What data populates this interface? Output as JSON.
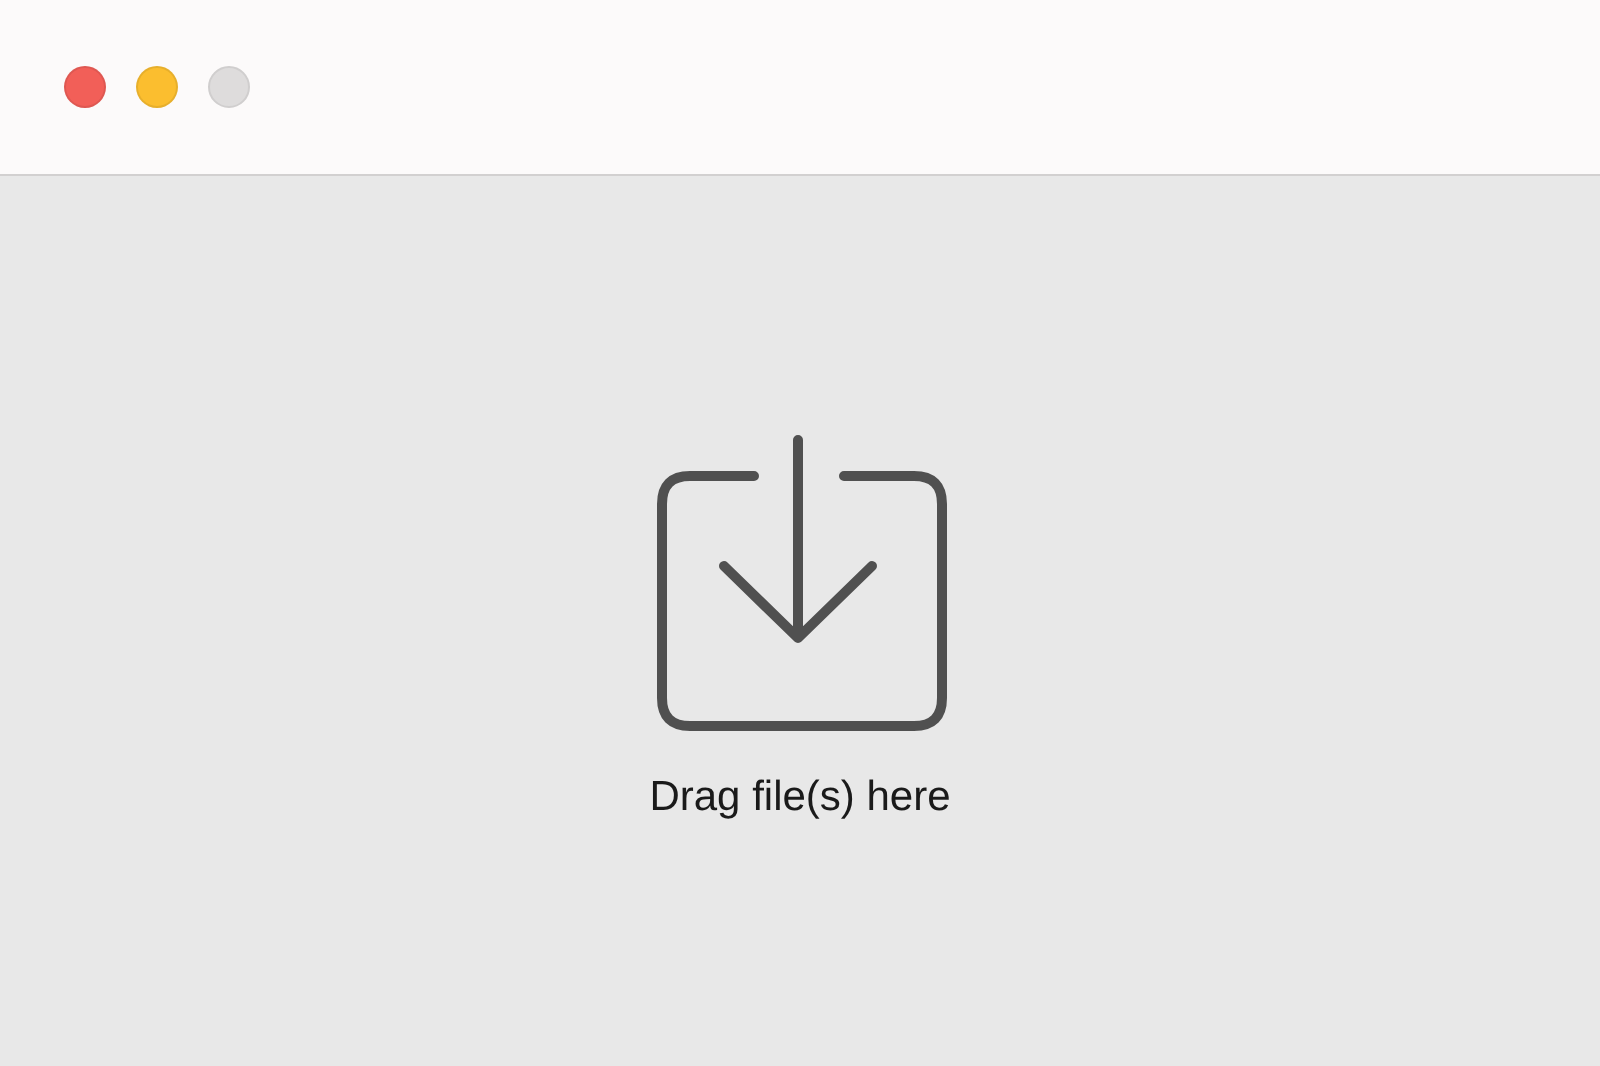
{
  "window": {
    "controls": [
      {
        "kind": "close",
        "disabled": false
      },
      {
        "kind": "minimize",
        "disabled": false
      },
      {
        "kind": "zoom",
        "disabled": true
      }
    ]
  },
  "drop_zone": {
    "label": "Drag file(s) here"
  }
}
